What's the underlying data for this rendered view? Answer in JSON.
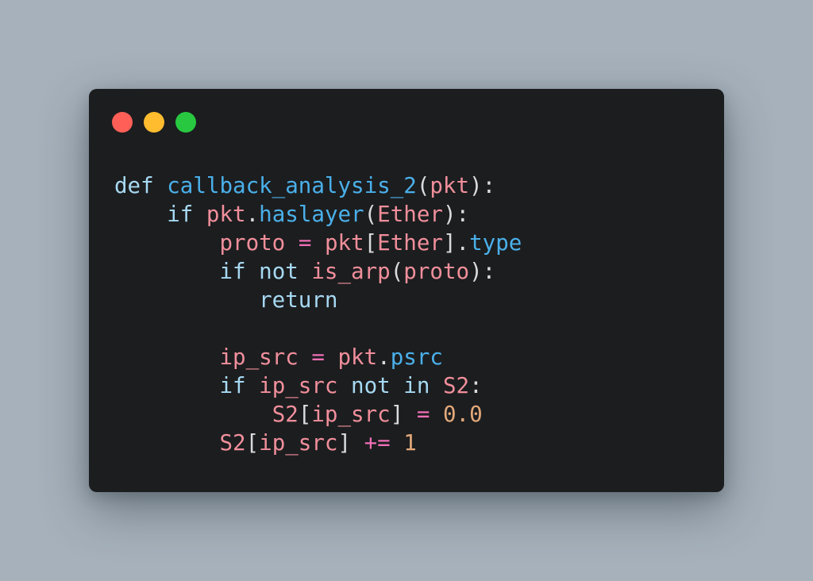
{
  "window": {
    "controls": {
      "close": {
        "color": "#ff5f57"
      },
      "minimize": {
        "color": "#febc2e"
      },
      "zoom": {
        "color": "#28c840"
      }
    }
  },
  "code": {
    "language": "python",
    "lines": [
      [
        {
          "t": "def",
          "c": "kw"
        },
        {
          "t": " "
        },
        {
          "t": "callback_analysis_2",
          "c": "fn"
        },
        {
          "t": "(",
          "c": "punct"
        },
        {
          "t": "pkt",
          "c": "var"
        },
        {
          "t": "):",
          "c": "punct"
        }
      ],
      [
        {
          "t": "    "
        },
        {
          "t": "if",
          "c": "kw"
        },
        {
          "t": " "
        },
        {
          "t": "pkt",
          "c": "var"
        },
        {
          "t": ".",
          "c": "punct"
        },
        {
          "t": "haslayer",
          "c": "fn"
        },
        {
          "t": "(",
          "c": "punct"
        },
        {
          "t": "Ether",
          "c": "var"
        },
        {
          "t": "):",
          "c": "punct"
        }
      ],
      [
        {
          "t": "        "
        },
        {
          "t": "proto",
          "c": "var"
        },
        {
          "t": " "
        },
        {
          "t": "=",
          "c": "op"
        },
        {
          "t": " "
        },
        {
          "t": "pkt",
          "c": "var"
        },
        {
          "t": "[",
          "c": "punct"
        },
        {
          "t": "Ether",
          "c": "var"
        },
        {
          "t": "].",
          "c": "punct"
        },
        {
          "t": "type",
          "c": "fn"
        }
      ],
      [
        {
          "t": "        "
        },
        {
          "t": "if",
          "c": "kw"
        },
        {
          "t": " "
        },
        {
          "t": "not",
          "c": "kw"
        },
        {
          "t": " "
        },
        {
          "t": "is_arp",
          "c": "var"
        },
        {
          "t": "(",
          "c": "punct"
        },
        {
          "t": "proto",
          "c": "var"
        },
        {
          "t": "):",
          "c": "punct"
        }
      ],
      [
        {
          "t": "           "
        },
        {
          "t": "return",
          "c": "kw"
        }
      ],
      [],
      [
        {
          "t": "        "
        },
        {
          "t": "ip_src",
          "c": "var"
        },
        {
          "t": " "
        },
        {
          "t": "=",
          "c": "op"
        },
        {
          "t": " "
        },
        {
          "t": "pkt",
          "c": "var"
        },
        {
          "t": ".",
          "c": "punct"
        },
        {
          "t": "psrc",
          "c": "fn"
        }
      ],
      [
        {
          "t": "        "
        },
        {
          "t": "if",
          "c": "kw"
        },
        {
          "t": " "
        },
        {
          "t": "ip_src",
          "c": "var"
        },
        {
          "t": " "
        },
        {
          "t": "not",
          "c": "kw"
        },
        {
          "t": " "
        },
        {
          "t": "in",
          "c": "kw"
        },
        {
          "t": " "
        },
        {
          "t": "S2",
          "c": "var"
        },
        {
          "t": ":",
          "c": "punct"
        }
      ],
      [
        {
          "t": "            "
        },
        {
          "t": "S2",
          "c": "var"
        },
        {
          "t": "[",
          "c": "punct"
        },
        {
          "t": "ip_src",
          "c": "var"
        },
        {
          "t": "]",
          "c": "punct"
        },
        {
          "t": " "
        },
        {
          "t": "=",
          "c": "op"
        },
        {
          "t": " "
        },
        {
          "t": "0.0",
          "c": "num"
        }
      ],
      [
        {
          "t": "        "
        },
        {
          "t": "S2",
          "c": "var"
        },
        {
          "t": "[",
          "c": "punct"
        },
        {
          "t": "ip_src",
          "c": "var"
        },
        {
          "t": "]",
          "c": "punct"
        },
        {
          "t": " "
        },
        {
          "t": "+=",
          "c": "op"
        },
        {
          "t": " "
        },
        {
          "t": "1",
          "c": "num"
        }
      ]
    ]
  }
}
